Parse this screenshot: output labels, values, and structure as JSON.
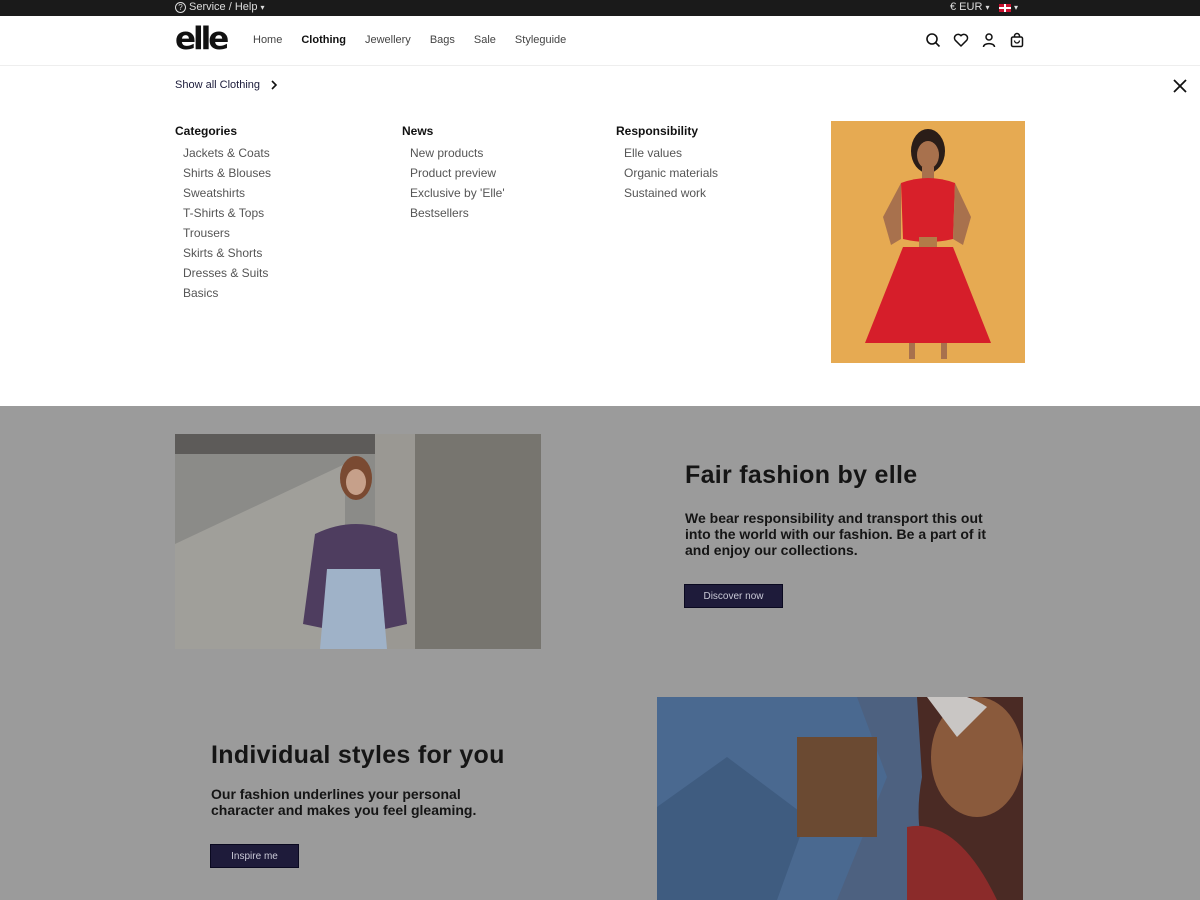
{
  "topbar": {
    "service_label": "Service / Help",
    "currency": "€ EUR"
  },
  "header": {
    "logo_text": "elle",
    "nav": [
      {
        "label": "Home"
      },
      {
        "label": "Clothing"
      },
      {
        "label": "Jewellery"
      },
      {
        "label": "Bags"
      },
      {
        "label": "Sale"
      },
      {
        "label": "Styleguide"
      }
    ],
    "icons": [
      "search-icon",
      "heart-icon",
      "user-icon",
      "cart-icon"
    ]
  },
  "mega_menu": {
    "show_all": "Show all Clothing",
    "columns": [
      {
        "title": "Categories",
        "items": [
          "Jackets & Coats",
          "Shirts & Blouses",
          "Sweatshirts",
          "T-Shirts & Tops",
          "Trousers",
          "Skirts & Shorts",
          "Dresses & Suits",
          "Basics"
        ]
      },
      {
        "title": "News",
        "items": [
          "New products",
          "Product preview",
          "Exclusive by 'Elle'",
          "Bestsellers"
        ]
      },
      {
        "title": "Responsibility",
        "items": [
          "Elle values",
          "Organic materials",
          "Sustained work"
        ]
      }
    ]
  },
  "sections": {
    "fair": {
      "title": "Fair fashion by elle",
      "text": "We bear responsibility and transport this out into the world with our fashion. Be a part of it and enjoy our collections.",
      "button": "Discover now"
    },
    "individual": {
      "title": "Individual styles for you",
      "text": "Our fashion underlines your personal character and makes you feel gleaming.",
      "button": "Inspire me"
    }
  },
  "colors": {
    "accent": "#1e1b3a",
    "overlay": "#9b9b9b",
    "topbar": "#1a1a1a"
  }
}
